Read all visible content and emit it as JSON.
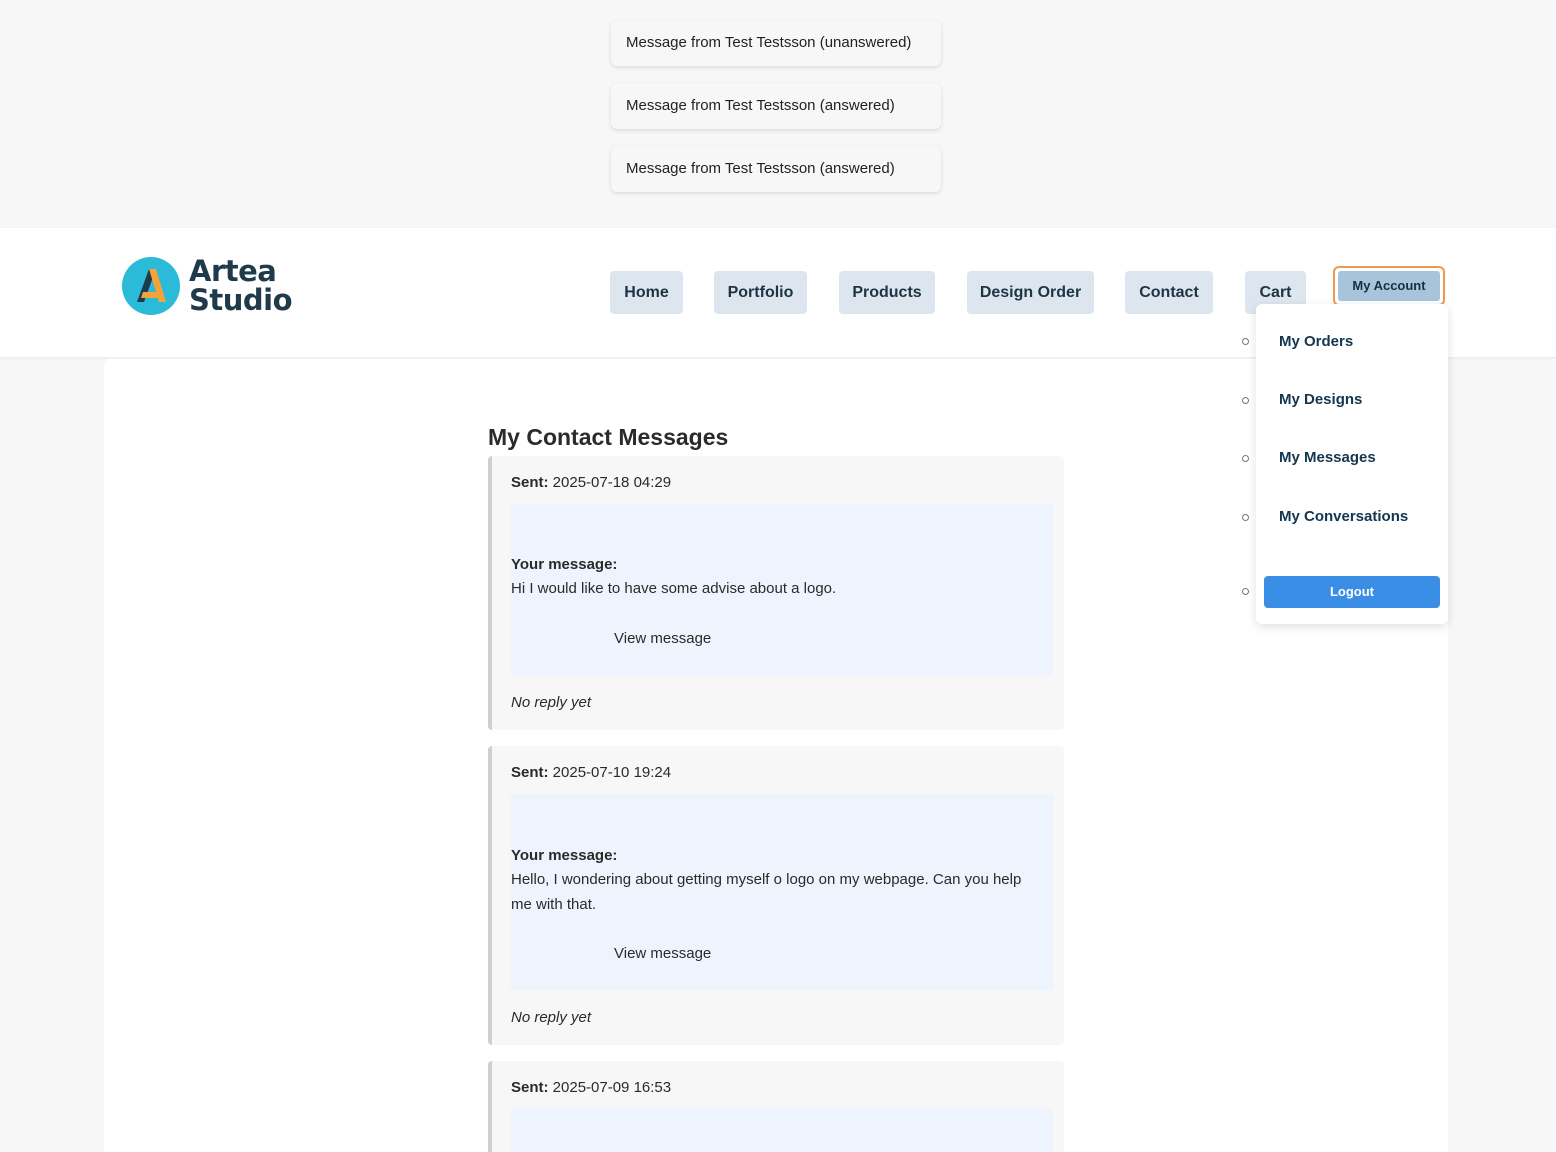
{
  "notifications": [
    {
      "text": "Message from Test Testsson (unanswered)"
    },
    {
      "text": "Message from Test Testsson (answered)"
    },
    {
      "text": "Message from Test Testsson (answered)"
    }
  ],
  "header": {
    "logo": {
      "line1": "Artea",
      "line2": "Studio",
      "icon": "artea-a-logo-icon",
      "colors": {
        "circle": "#2bbbd8",
        "letter_left": "#1f3a4a",
        "letter_right": "#f5a23a"
      }
    },
    "nav": [
      {
        "label": "Home"
      },
      {
        "label": "Portfolio"
      },
      {
        "label": "Products"
      },
      {
        "label": "Design Order"
      },
      {
        "label": "Contact"
      },
      {
        "label": "Cart"
      }
    ],
    "account_button": "My Account"
  },
  "dropdown": {
    "items": [
      {
        "label": "My Orders"
      },
      {
        "label": "My Designs"
      },
      {
        "label": "My Messages"
      },
      {
        "label": "My Conversations"
      }
    ],
    "logout": "Logout"
  },
  "page": {
    "title": "My Contact Messages",
    "sent_label": "Sent:",
    "your_message_label": "Your message:",
    "view_label": "View message",
    "messages": [
      {
        "sent": "2025-07-18 04:29",
        "text": "Hi I would like to have some advise about a logo.",
        "reply": "No reply yet"
      },
      {
        "sent": "2025-07-10 19:24",
        "text": "Hello, I wondering about getting myself o logo on my webpage. Can you help me with that.",
        "reply": "No reply yet"
      },
      {
        "sent": "2025-07-09 16:53",
        "text": "",
        "reply": ""
      }
    ]
  },
  "colors": {
    "accent": "#3a8ee6",
    "nav_bg": "#dde6ee",
    "account_bg": "#a7c4db",
    "account_focus": "#ee9a4d",
    "message_bg": "#eef4fd"
  }
}
